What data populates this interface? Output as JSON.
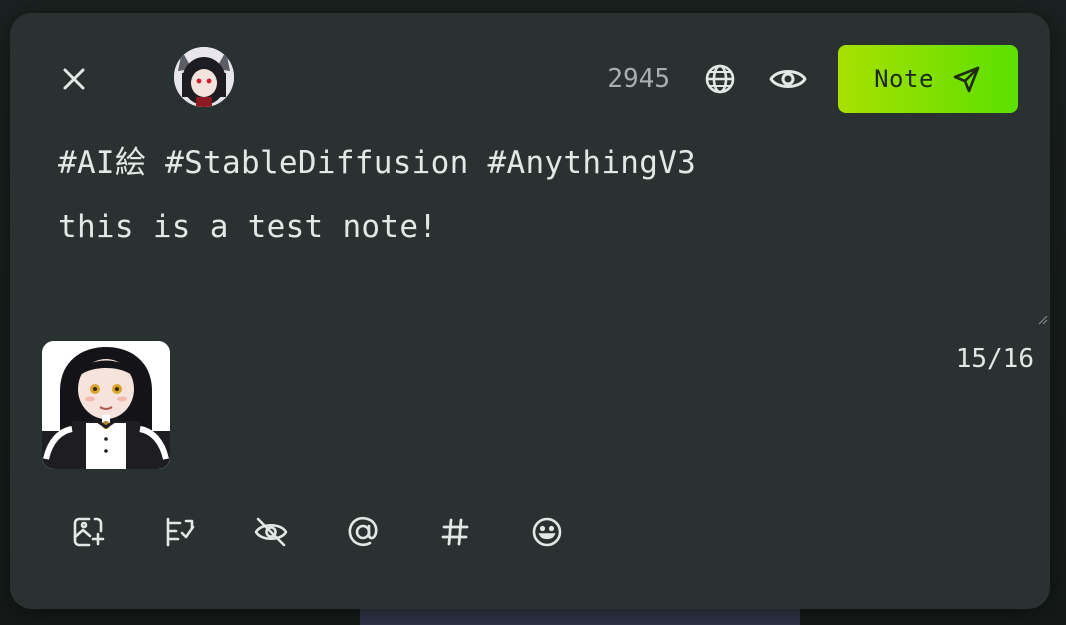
{
  "header": {
    "close_icon": "close-icon",
    "avatar_alt": "user-avatar",
    "remaining_chars": "2945",
    "visibility_icon": "globe-icon",
    "local_only_icon": "eye-icon",
    "post_button_label": "Note",
    "post_button_icon": "send-icon"
  },
  "editor": {
    "lines": [
      "#AI絵 #StableDiffusion #AnythingV3",
      "this is a test note!"
    ]
  },
  "attachments": {
    "count_label": "15/16",
    "items": [
      {
        "type": "image",
        "alt": "anime-maid-girl"
      }
    ]
  },
  "footer": {
    "tools": [
      {
        "name": "attach-image-icon"
      },
      {
        "name": "poll-icon"
      },
      {
        "name": "hide-content-icon"
      },
      {
        "name": "mention-icon"
      },
      {
        "name": "hashtag-icon"
      },
      {
        "name": "emoji-icon"
      }
    ]
  },
  "colors": {
    "modal_bg": "#2a3231",
    "text": "#e3e8e6",
    "muted": "#a8aeb0",
    "accent_start": "#a8e000",
    "accent_end": "#5ce000"
  }
}
